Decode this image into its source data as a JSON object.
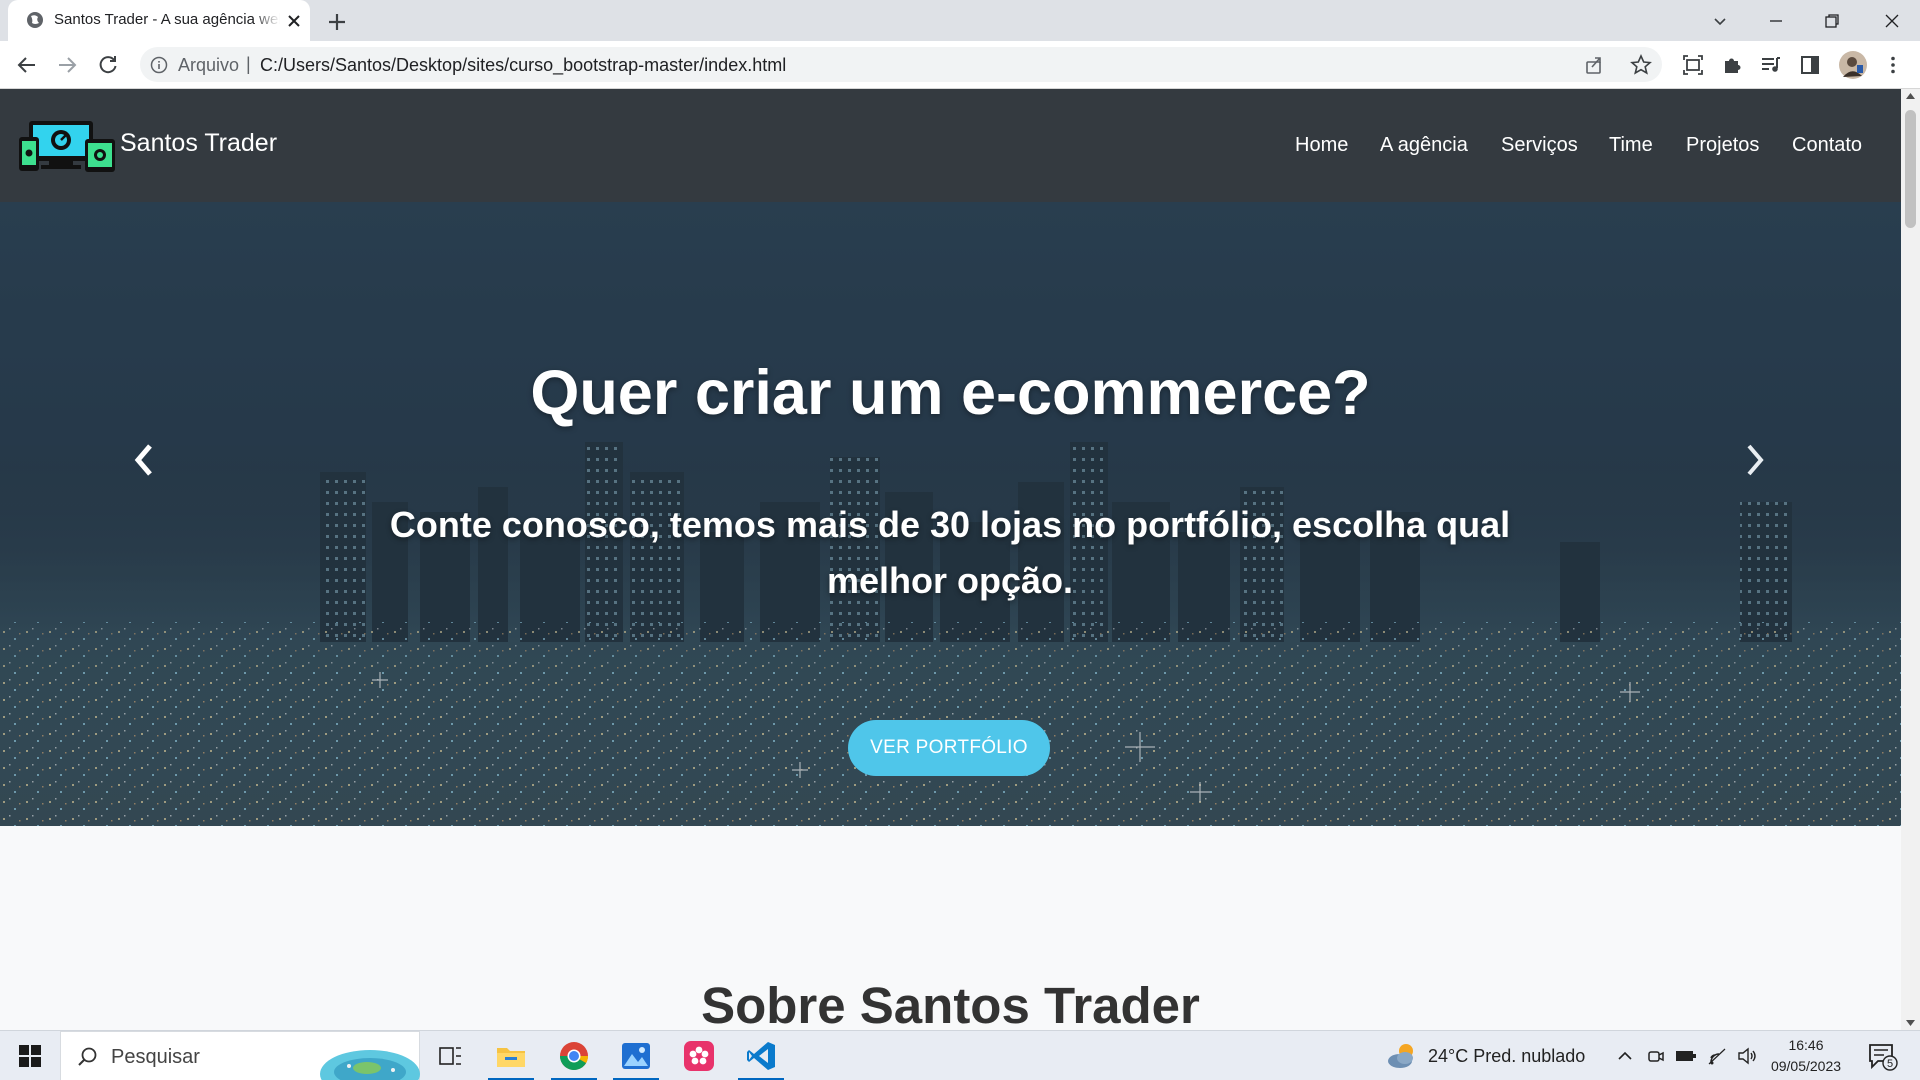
{
  "browser": {
    "tab_title": "Santos Trader - A sua agência web",
    "scheme_label": "Arquivo",
    "scheme_separator": "|",
    "url": "C:/Users/Santos/Desktop/sites/curso_bootstrap-master/index.html"
  },
  "site": {
    "brand": "Santos Trader",
    "nav": [
      "Home",
      "A agência",
      "Serviços",
      "Time",
      "Projetos",
      "Contato"
    ],
    "hero": {
      "title": "Quer criar um e-commerce?",
      "subtitle": "Conte conosco, temos mais de 30 lojas no portfólio, escolha qual melhor opção.",
      "cta": "VER PORTFÓLIO"
    },
    "about_title": "Sobre Santos Trader"
  },
  "taskbar": {
    "search_placeholder": "Pesquisar",
    "weather": "24°C  Pred. nublado",
    "time": "16:46",
    "date": "09/05/2023",
    "notification_count": "5",
    "apps": [
      "task-view",
      "file-explorer",
      "chrome",
      "photos",
      "flower-app",
      "vscode"
    ]
  },
  "colors": {
    "navbar": "#343a40",
    "cta": "#4fc6ea",
    "tabstrip": "#dee1e6",
    "taskbar": "#e8ecf3"
  }
}
